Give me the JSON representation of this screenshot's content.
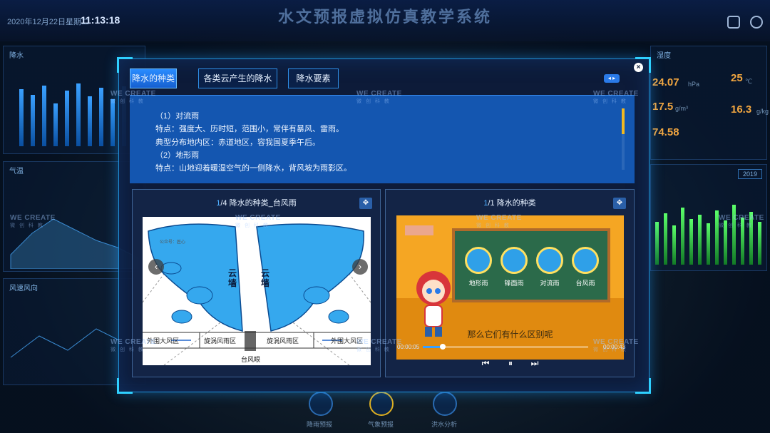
{
  "system": {
    "title": "水文预报虚拟仿真教学系统",
    "date": "2020年12月22日星期二",
    "time": "11:13:18"
  },
  "background": {
    "left_panels": [
      {
        "title": "降水"
      },
      {
        "title": "气温"
      },
      {
        "title": "风速风向"
      }
    ],
    "right_panels": [
      {
        "title": "湿度"
      }
    ],
    "stats": [
      "24.07",
      "25",
      "17.5",
      "16.3",
      "74.58"
    ],
    "units": [
      "hPa",
      "℃",
      "g/m³",
      "g/kg"
    ],
    "year_select": "2019",
    "bottom_buttons": [
      "降雨预报",
      "气象预报",
      "洪水分析"
    ]
  },
  "watermark": {
    "brand": "WE CREATE",
    "sub": "微 创 科 教"
  },
  "dialog": {
    "close_label": "×",
    "pager_label": "◂ ▸",
    "tabs": [
      {
        "label": "降水的种类",
        "active": true
      },
      {
        "label": "各类云产生的降水",
        "active": false
      },
      {
        "label": "降水要素",
        "active": false
      }
    ],
    "text_lines": [
      "（1）对流雨",
      "特点：强度大、历时短，范围小，常伴有暴风、雷雨。",
      "典型分布地内区：赤道地区，容我国夏季午后。",
      "（2）地形雨",
      "特点：山地迎着暖湿空气的一侧降水，背风坡为雨影区。"
    ],
    "image_panel": {
      "index": "1",
      "total": "/4",
      "title": "降水的种类_台风雨",
      "prev_label": "‹",
      "next_label": "›",
      "expand_label": "✥",
      "diagram": {
        "wall_label_left": "云墙",
        "wall_label_right": "云墙",
        "zones": [
          "外围大风区",
          "旋涡风雨区",
          "旋涡风雨区",
          "外围大风区"
        ],
        "eye_label": "台风眼",
        "caption": "公众号：匠心"
      }
    },
    "video_panel": {
      "index": "1",
      "total": "/1",
      "title": "降水的种类",
      "expand_label": "✥",
      "items": [
        "地形雨",
        "锋面雨",
        "对流雨",
        "台风雨"
      ],
      "subtitle": "那么它们有什么区别呢",
      "current_time": "00:00:05",
      "duration": "00:00:43",
      "progress": 0.12,
      "prev_label": "⏮",
      "pause_label": "⏸",
      "next_label": "⏭"
    }
  },
  "colors": {
    "accent": "#2a8cff",
    "text_panel": "#1456b0",
    "scroll_thumb": "#f2b820",
    "stat_orange": "#f2a640"
  }
}
